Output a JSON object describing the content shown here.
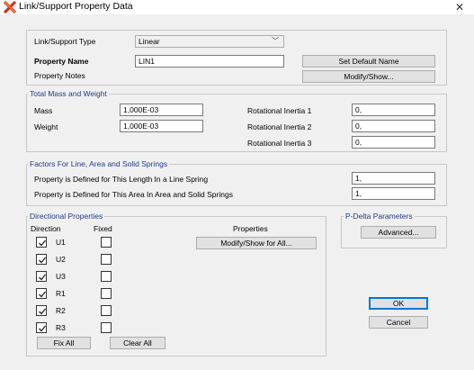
{
  "window": {
    "title": "Link/Support Property Data"
  },
  "top": {
    "type_label": "Link/Support Type",
    "type_value": "Linear",
    "name_label": "Property Name",
    "name_value": "LIN1",
    "set_default_label": "Set Default Name",
    "notes_label": "Property Notes",
    "modify_show_label": "Modify/Show..."
  },
  "mass": {
    "title": "Total Mass and Weight",
    "mass_label": "Mass",
    "mass_value": "1,000E-03",
    "weight_label": "Weight",
    "weight_value": "1,000E-03",
    "rot1_label": "Rotational Inertia 1",
    "rot1_value": "0,",
    "rot2_label": "Rotational Inertia 2",
    "rot2_value": "0,",
    "rot3_label": "Rotational Inertia 3",
    "rot3_value": "0,"
  },
  "factors": {
    "title": "Factors For Line, Area and Solid Springs",
    "length_label": "Property is Defined for This Length In a Line Spring",
    "length_value": "1,",
    "area_label": "Property is Defined for This Area In Area and Solid Springs",
    "area_value": "1,"
  },
  "directional": {
    "title": "Directional Properties",
    "direction_header": "Direction",
    "fixed_header": "Fixed",
    "properties_header": "Properties",
    "modify_all_label": "Modify/Show for All...",
    "dofs": [
      {
        "label": "U1",
        "direction": true,
        "fixed": false
      },
      {
        "label": "U2",
        "direction": true,
        "fixed": false
      },
      {
        "label": "U3",
        "direction": true,
        "fixed": false
      },
      {
        "label": "R1",
        "direction": true,
        "fixed": false
      },
      {
        "label": "R2",
        "direction": true,
        "fixed": false
      },
      {
        "label": "R3",
        "direction": true,
        "fixed": false
      }
    ],
    "fix_all_label": "Fix All",
    "clear_all_label": "Clear All"
  },
  "pdelta": {
    "title": "P-Delta Parameters",
    "advanced_label": "Advanced..."
  },
  "actions": {
    "ok_label": "OK",
    "cancel_label": "Cancel"
  }
}
